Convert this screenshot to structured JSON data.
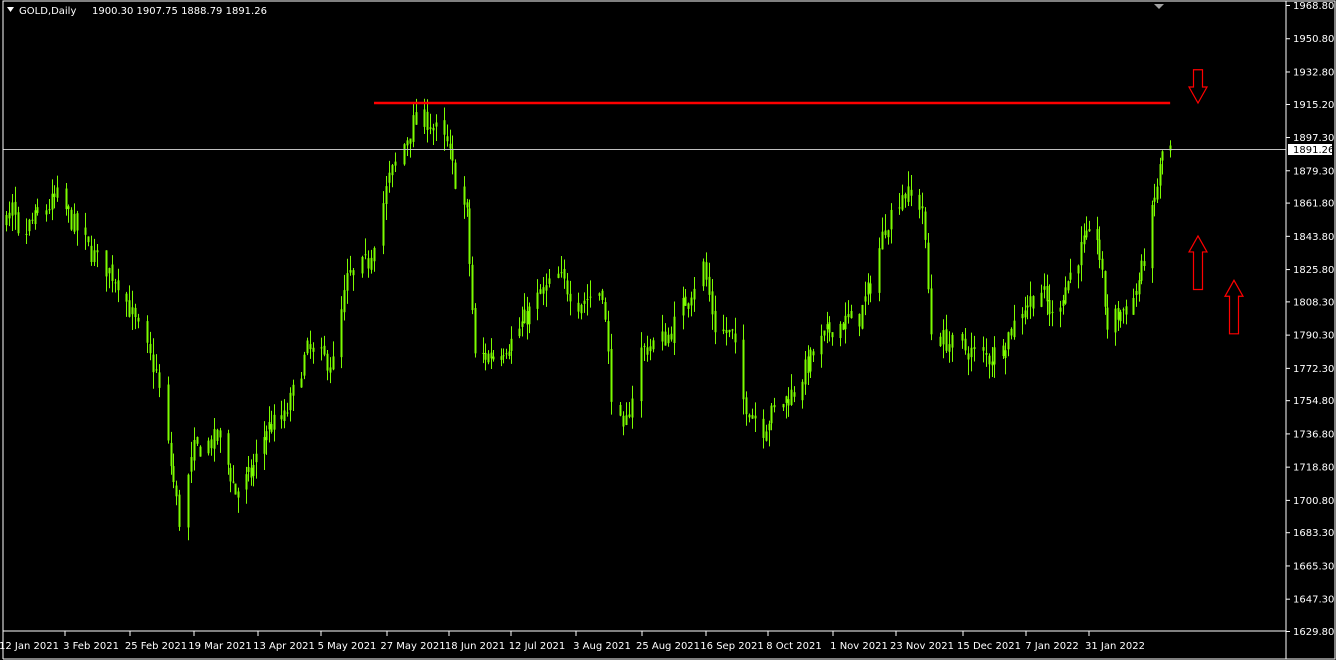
{
  "header": {
    "symbol": "GOLD,Daily",
    "ohlc": "1900.30 1907.75 1888.79 1891.26"
  },
  "price_tag": "1891.26",
  "colors": {
    "background": "#000000",
    "candle": "#7CFC00",
    "axis": "#ffffff",
    "resistance": "#ff0000",
    "arrow": "#ff0000",
    "price_line": "#c0c0c0"
  },
  "chart_data": {
    "type": "candlestick",
    "symbol": "GOLD",
    "timeframe": "Daily",
    "y_ticks": [
      "1968.80",
      "1950.80",
      "1932.80",
      "1915.20",
      "1897.30",
      "1879.30",
      "1861.80",
      "1843.80",
      "1825.80",
      "1808.30",
      "1790.30",
      "1772.30",
      "1754.80",
      "1736.80",
      "1718.80",
      "1700.80",
      "1683.30",
      "1665.30",
      "1647.30",
      "1629.80"
    ],
    "x_ticks": [
      "12 Jan 2021",
      "3 Feb 2021",
      "25 Feb 2021",
      "19 Mar 2021",
      "13 Apr 2021",
      "5 May 2021",
      "27 May 2021",
      "18 Jun 2021",
      "12 Jul 2021",
      "3 Aug 2021",
      "25 Aug 2021",
      "16 Sep 2021",
      "8 Oct 2021",
      "1 Nov 2021",
      "23 Nov 2021",
      "15 Dec 2021",
      "7 Jan 2022",
      "31 Jan 2022"
    ],
    "ylim": [
      1629.8,
      1968.8
    ],
    "current_price": 1891.26,
    "resistance_level": 1916.0,
    "close_path": [
      [
        "12 Jan 2021",
        1850
      ],
      [
        "22 Jan 2021",
        1865
      ],
      [
        "3 Feb 2021",
        1835
      ],
      [
        "12 Feb 2021",
        1820
      ],
      [
        "25 Feb 2021",
        1770
      ],
      [
        "5 Mar 2021",
        1690
      ],
      [
        "10 Mar 2021",
        1728
      ],
      [
        "19 Mar 2021",
        1735
      ],
      [
        "25 Mar 2021",
        1705
      ],
      [
        "31 Mar 2021",
        1715
      ],
      [
        "6 Apr 2021",
        1740
      ],
      [
        "13 Apr 2021",
        1745
      ],
      [
        "21 Apr 2021",
        1782
      ],
      [
        "30 Apr 2021",
        1775
      ],
      [
        "5 May 2021",
        1820
      ],
      [
        "12 May 2021",
        1830
      ],
      [
        "19 May 2021",
        1875
      ],
      [
        "27 May 2021",
        1905
      ],
      [
        "1 Jun 2021",
        1907
      ],
      [
        "8 Jun 2021",
        1893
      ],
      [
        "11 Jun 2021",
        1875
      ],
      [
        "15 Jun 2021",
        1855
      ],
      [
        "18 Jun 2021",
        1778
      ],
      [
        "25 Jun 2021",
        1780
      ],
      [
        "2 Jul 2021",
        1787
      ],
      [
        "12 Jul 2021",
        1810
      ],
      [
        "19 Jul 2021",
        1822
      ],
      [
        "26 Jul 2021",
        1808
      ],
      [
        "3 Aug 2021",
        1815
      ],
      [
        "6 Aug 2021",
        1760
      ],
      [
        "10 Aug 2021",
        1735
      ],
      [
        "16 Aug 2021",
        1782
      ],
      [
        "25 Aug 2021",
        1790
      ],
      [
        "1 Sep 2021",
        1812
      ],
      [
        "6 Sep 2021",
        1828
      ],
      [
        "10 Sep 2021",
        1795
      ],
      [
        "16 Sep 2021",
        1790
      ],
      [
        "20 Sep 2021",
        1755
      ],
      [
        "27 Sep 2021",
        1740
      ],
      [
        "1 Oct 2021",
        1750
      ],
      [
        "8 Oct 2021",
        1760
      ],
      [
        "15 Oct 2021",
        1780
      ],
      [
        "22 Oct 2021",
        1795
      ],
      [
        "1 Nov 2021",
        1800
      ],
      [
        "5 Nov 2021",
        1818
      ],
      [
        "10 Nov 2021",
        1850
      ],
      [
        "16 Nov 2021",
        1868
      ],
      [
        "23 Nov 2021",
        1860
      ],
      [
        "26 Nov 2021",
        1792
      ],
      [
        "3 Dec 2021",
        1785
      ],
      [
        "15 Dec 2021",
        1778
      ],
      [
        "20 Dec 2021",
        1785
      ],
      [
        "27 Dec 2021",
        1805
      ],
      [
        "3 Jan 2022",
        1815
      ],
      [
        "7 Jan 2022",
        1800
      ],
      [
        "13 Jan 2022",
        1820
      ],
      [
        "19 Jan 2022",
        1840
      ],
      [
        "24 Jan 2022",
        1845
      ],
      [
        "28 Jan 2022",
        1795
      ],
      [
        "31 Jan 2022",
        1800
      ],
      [
        "7 Feb 2022",
        1810
      ],
      [
        "10 Feb 2022",
        1825
      ],
      [
        "14 Feb 2022",
        1855
      ],
      [
        "17 Feb 2022",
        1880
      ],
      [
        "19 Feb 2022",
        1898
      ],
      [
        "21 Feb 2022",
        1891
      ]
    ],
    "annotations": [
      {
        "type": "horizontal-line",
        "y": 1916.0,
        "x_start": "14 May 2021",
        "x_end": "21 Feb 2022"
      },
      {
        "type": "arrow",
        "direction": "down",
        "y_top": 1934,
        "y_bottom": 1916
      },
      {
        "type": "arrow",
        "direction": "up",
        "y_top": 1844,
        "y_bottom": 1815
      },
      {
        "type": "arrow",
        "direction": "up",
        "y_top": 1820,
        "y_bottom": 1791
      }
    ]
  }
}
